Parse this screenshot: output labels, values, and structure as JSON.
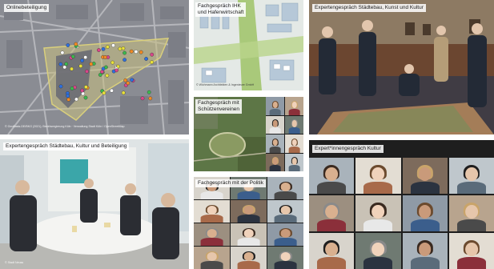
{
  "tiles": {
    "online": {
      "title": "Onlinebeteiligung",
      "credit": "© GeoBasis-DE/BKG (2021), Bezirksregierung Köln · Verwaltung Stadt Köln / OpenStreetMap"
    },
    "ihk": {
      "title": "Fachgespräch IHK\nund Hafenwirtschaft",
      "credit": "© Wichmann Architekten & Ingenieure GmbH"
    },
    "kunst": {
      "title": "Expertengespräch Städtebau, Kunst und Kultur"
    },
    "schuetzen": {
      "title": "Fachgespräch mit\nSchützenvereinen"
    },
    "beteiligung": {
      "title": "Expertengespräch Städtebau, Kultur und Beteiligung",
      "credit": "© Stadt Neuss"
    },
    "politik": {
      "title": "Fachgespräch mit der Politik"
    },
    "expertinnen": {
      "title": "Expert*innengespräch Kultur"
    }
  },
  "colors": {
    "caption_bg": "#ffffff",
    "caption_text": "#1a1a1a",
    "map_bg": "#8e9098",
    "aerial_green": "#5d7646",
    "room_wood": "#6b4630",
    "video_bg": "#1e1e1e"
  },
  "markers": [
    "#e8e03a",
    "#d9468a",
    "#3bb94e",
    "#2d6fe0",
    "#ffffff",
    "#f08a24"
  ]
}
